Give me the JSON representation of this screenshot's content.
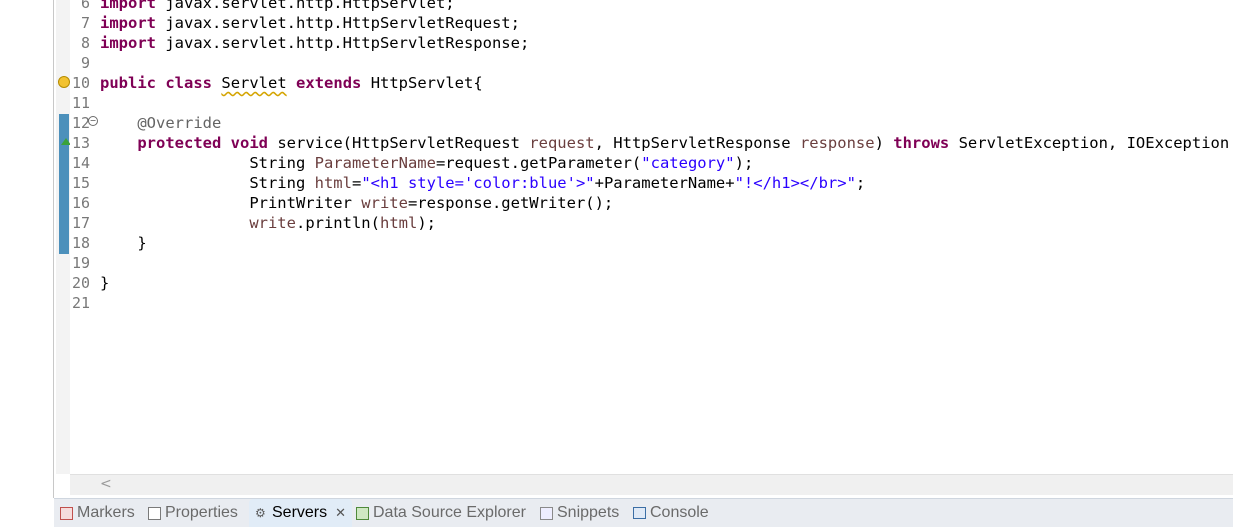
{
  "editor": {
    "lines": [
      {
        "num": "6"
      },
      {
        "num": "7"
      },
      {
        "num": "8"
      },
      {
        "num": "9"
      },
      {
        "num": "10"
      },
      {
        "num": "11"
      },
      {
        "num": "12"
      },
      {
        "num": "13"
      },
      {
        "num": "14"
      },
      {
        "num": "15"
      },
      {
        "num": "16"
      },
      {
        "num": "17"
      },
      {
        "num": "18"
      },
      {
        "num": "19"
      },
      {
        "num": "20"
      },
      {
        "num": "21"
      }
    ],
    "tokens": {
      "import": "import",
      "pkg_servlet": " javax.servlet.http.HttpServlet;",
      "pkg_request": " javax.servlet.http.HttpServletRequest;",
      "pkg_response": " javax.servlet.http.HttpServletResponse;",
      "public": "public",
      "class": "class",
      "class_name": "Servlet",
      "extends": "extends",
      "super_class": " HttpServlet{",
      "override": "@Override",
      "protected": "protected",
      "void": "void",
      "method_sig_1": " service(HttpServletRequest ",
      "param_request": "request",
      "method_sig_2": ", HttpServletResponse ",
      "param_response": "response",
      "method_sig_3": ") ",
      "throws": "throws",
      "method_sig_4": " ServletException, IOException {",
      "l14_a": "String ",
      "l14_var": "ParameterName",
      "l14_b": "=request.getParameter(",
      "l14_str": "\"category\"",
      "l14_c": ");",
      "l15_a": "String ",
      "l15_var": "html",
      "l15_b": "=",
      "l15_str1": "\"<h1 style='color:blue'>\"",
      "l15_c": "+ParameterName+",
      "l15_str2": "\"!</h1></br>\"",
      "l15_d": ";",
      "l16_a": "PrintWriter ",
      "l16_var": "write",
      "l16_b": "=response.getWriter();",
      "l17_var": "write",
      "l17_b": ".println(",
      "l17_var2": "html",
      "l17_c": ");",
      "close_method": "}",
      "close_class": "}"
    }
  },
  "bottom_panel": {
    "tabs": [
      {
        "label": "Markers",
        "icon": "markers-icon"
      },
      {
        "label": "Properties",
        "icon": "properties-icon"
      },
      {
        "label": "Servers",
        "icon": "servers-icon",
        "active": true
      },
      {
        "label": "Data Source Explorer",
        "icon": "data-source-explorer-icon"
      },
      {
        "label": "Snippets",
        "icon": "snippets-icon"
      },
      {
        "label": "Console",
        "icon": "console-icon"
      }
    ],
    "close_glyph": "✕"
  },
  "colors": {
    "keyword": "#7f0055",
    "string": "#2a00ff",
    "annotation": "#646464",
    "local_var": "#6a3e3e",
    "current_line": "#e8f2fe"
  }
}
